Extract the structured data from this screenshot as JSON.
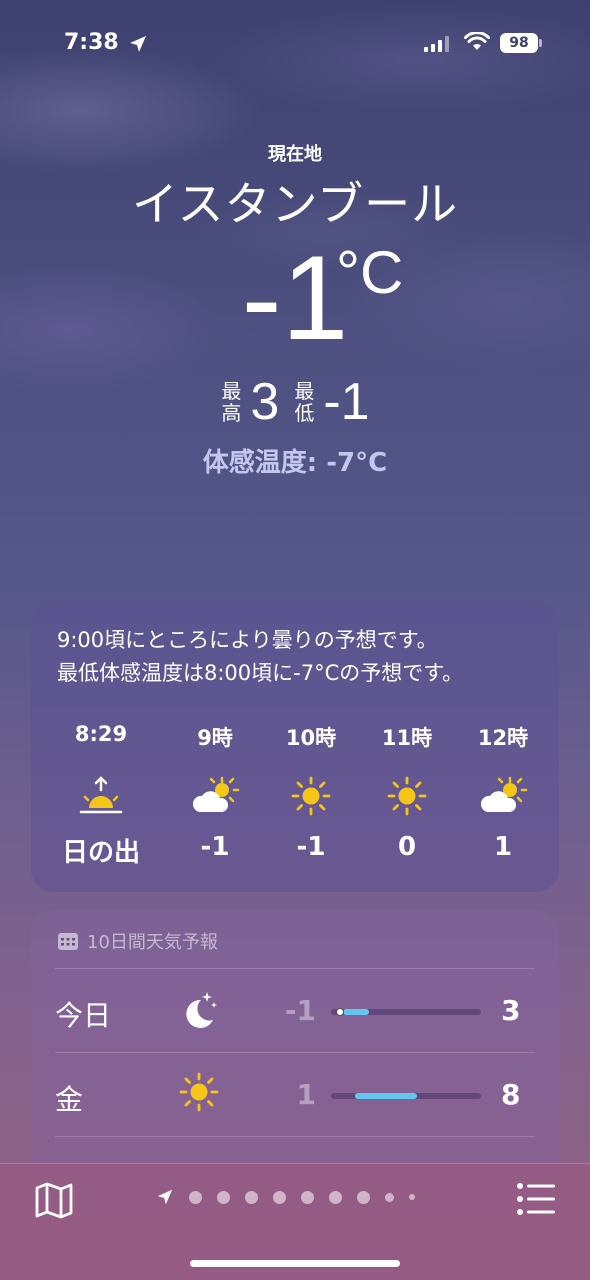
{
  "status_bar": {
    "time": "7:38",
    "battery": "98"
  },
  "location": {
    "label": "現在地",
    "city": "イスタンブール"
  },
  "current": {
    "temperature": "-1",
    "unit": "°C",
    "high_label": "最高",
    "high": "3",
    "low_label": "最低",
    "low": "-1",
    "feels_like": "体感温度: -7°C"
  },
  "hourly": {
    "summary_line1": "9:00頃にところにより曇りの予想です。",
    "summary_line2": "最低体感温度は8:00頃に-7°Cの予想です。",
    "items": [
      {
        "time": "8:29",
        "icon": "sunrise-icon",
        "value": "日の出"
      },
      {
        "time": "9時",
        "icon": "partly-cloudy-icon",
        "value": "-1"
      },
      {
        "time": "10時",
        "icon": "sun-icon",
        "value": "-1"
      },
      {
        "time": "11時",
        "icon": "sun-icon",
        "value": "0"
      },
      {
        "time": "12時",
        "icon": "partly-cloudy-icon",
        "value": "1"
      }
    ]
  },
  "daily": {
    "header": "10日間天気予報",
    "days": [
      {
        "day": "今日",
        "icon": "moon-stars-icon",
        "low": "-1",
        "high": "3",
        "range_start": 0.08,
        "range_end": 0.25,
        "current": 0.03
      },
      {
        "day": "金",
        "icon": "sun-icon",
        "low": "1",
        "high": "8",
        "range_start": 0.16,
        "range_end": 0.57
      }
    ]
  },
  "colors": {
    "range_bar": "#63c6f0",
    "sun": "#f5c518",
    "feels_like": "#c4c6ee"
  },
  "bottom_bar": {
    "page_count": 9
  }
}
